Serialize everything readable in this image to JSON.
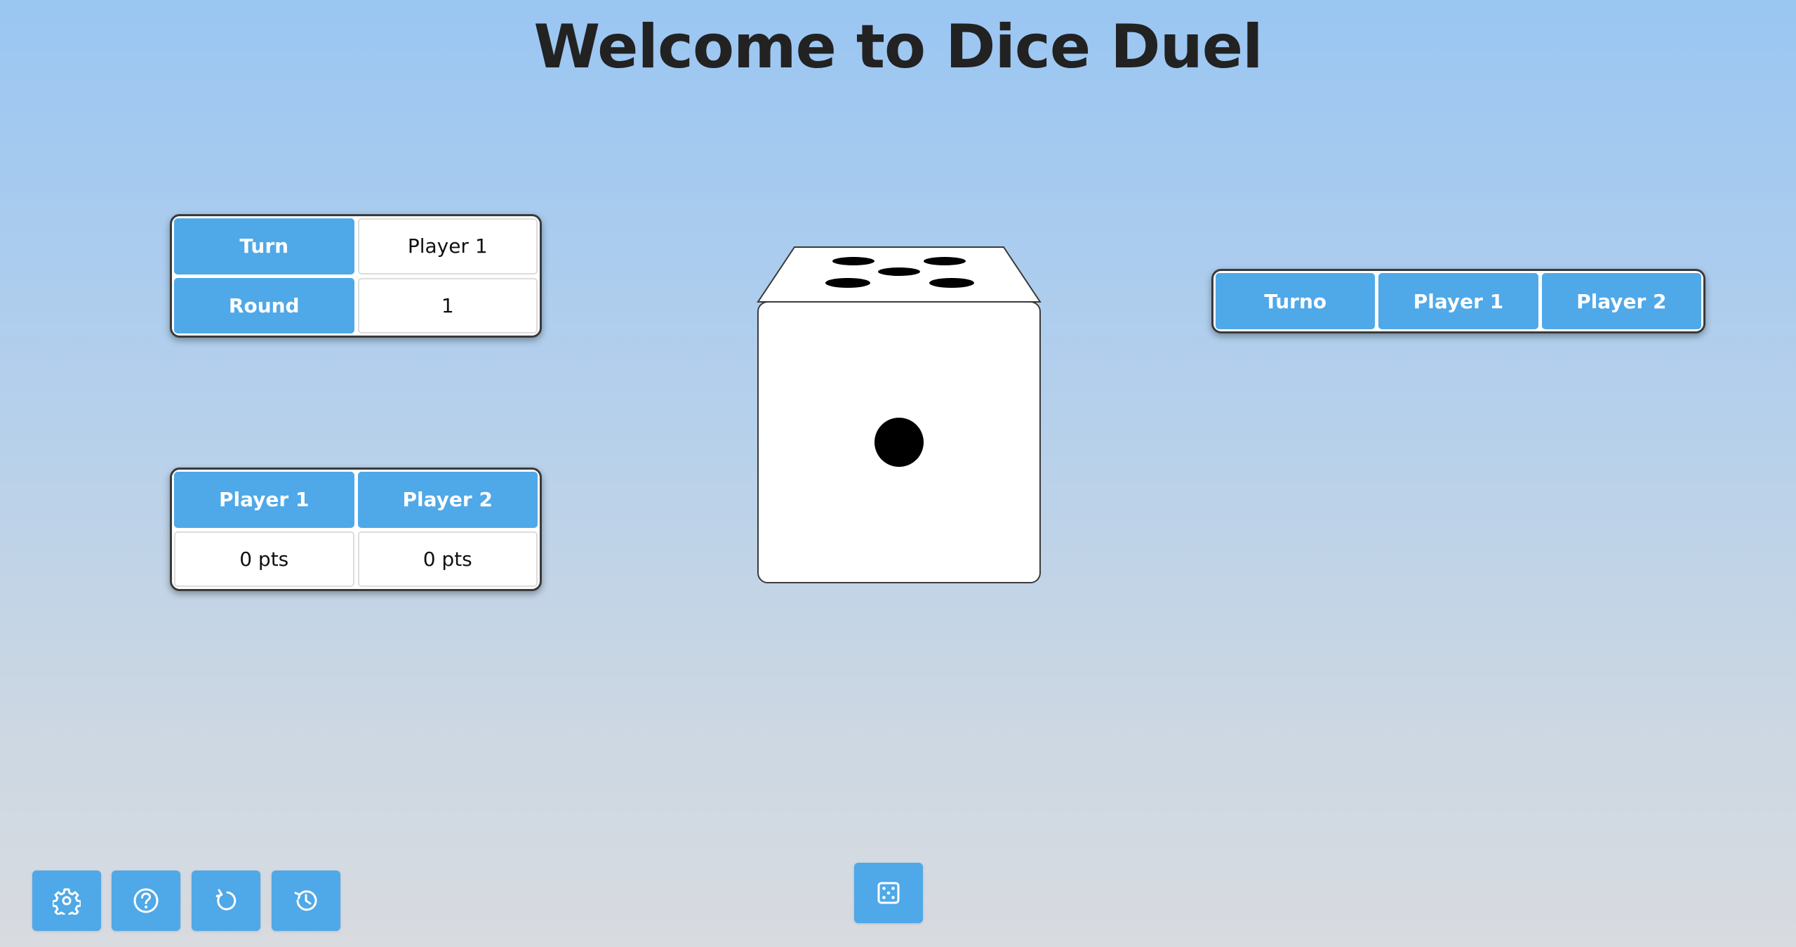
{
  "header": {
    "title": "Welcome to Dice Duel"
  },
  "info": {
    "turn_label": "Turn",
    "turn_value": "Player 1",
    "round_label": "Round",
    "round_value": "1"
  },
  "scores": {
    "player1_label": "Player 1",
    "player2_label": "Player 2",
    "player1_score": "0 pts",
    "player2_score": "0 pts"
  },
  "history": {
    "columns": [
      "Turno",
      "Player 1",
      "Player 2"
    ]
  },
  "die": {
    "front_face": 1,
    "top_face": 5
  },
  "toolbar": {
    "buttons": [
      {
        "icon": "gear-icon"
      },
      {
        "icon": "help-icon"
      },
      {
        "icon": "restart-icon"
      },
      {
        "icon": "history-icon"
      }
    ],
    "roll_icon": "dice-icon"
  },
  "colors": {
    "accent": "#4fa8e8",
    "title": "#222222",
    "background_top": "#9ac6f2",
    "background_bottom": "#d8dbe0"
  }
}
